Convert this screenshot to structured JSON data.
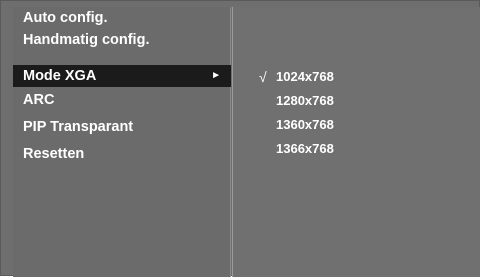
{
  "menu": {
    "items": [
      {
        "label": "Auto config."
      },
      {
        "label": "Handmatig config."
      },
      {
        "label": "Mode XGA",
        "selected": true,
        "submenu_arrow": "►"
      },
      {
        "label": "ARC"
      },
      {
        "label": "PIP Transparant"
      },
      {
        "label": "Resetten"
      }
    ]
  },
  "submenu": {
    "check_glyph": "√",
    "options": [
      {
        "label": "1024x768",
        "checked": true
      },
      {
        "label": "1280x768"
      },
      {
        "label": "1360x768"
      },
      {
        "label": "1366x768"
      }
    ]
  },
  "colors": {
    "panel_bg": "#6b6b6b",
    "selected_bg": "#1b1b1b",
    "text": "#ffffff"
  }
}
